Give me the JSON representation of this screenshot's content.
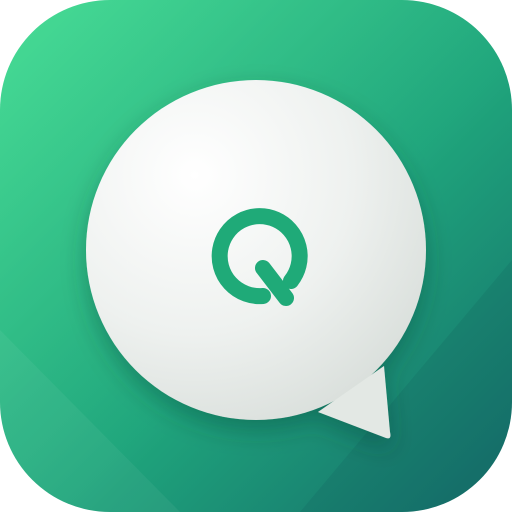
{
  "app_icon": {
    "icon_name": "chat-bubble-q-icon",
    "colors": {
      "gradient_top_left": "#34d98a",
      "gradient_mid": "#1fa67c",
      "gradient_bottom_right": "#156b6a",
      "bubble_fill": "#eef1ef",
      "bubble_highlight": "#ffffff",
      "bubble_shade": "#d6dcd8",
      "glyph": "#1faa78"
    }
  }
}
